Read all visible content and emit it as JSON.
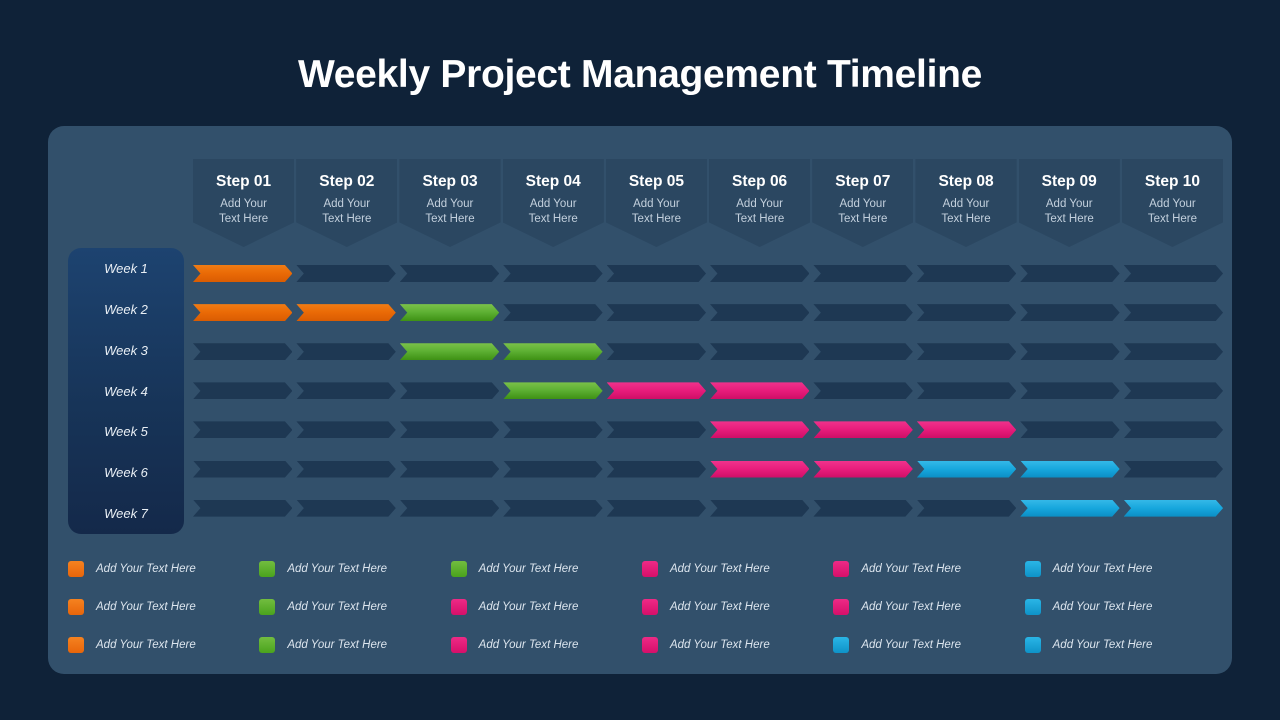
{
  "page": {
    "title": "Weekly Project Management Timeline",
    "background_color": "#0f2238",
    "panel_color": "#32506b"
  },
  "steps": [
    {
      "title": "Step 01",
      "subtitle": "Add Your\nText Here"
    },
    {
      "title": "Step 02",
      "subtitle": "Add Your\nText Here"
    },
    {
      "title": "Step 03",
      "subtitle": "Add Your\nText Here"
    },
    {
      "title": "Step 04",
      "subtitle": "Add Your\nText Here"
    },
    {
      "title": "Step 05",
      "subtitle": "Add Your\nText Here"
    },
    {
      "title": "Step 06",
      "subtitle": "Add Your\nText Here"
    },
    {
      "title": "Step 07",
      "subtitle": "Add Your\nText Here"
    },
    {
      "title": "Step 08",
      "subtitle": "Add Your\nText Here"
    },
    {
      "title": "Step 09",
      "subtitle": "Add Your\nText Here"
    },
    {
      "title": "Step 10",
      "subtitle": "Add Your\nText Here"
    }
  ],
  "weeks": [
    {
      "label": "Week 1"
    },
    {
      "label": "Week 2"
    },
    {
      "label": "Week 3"
    },
    {
      "label": "Week 4"
    },
    {
      "label": "Week 5"
    },
    {
      "label": "Week 6"
    },
    {
      "label": "Week 7"
    }
  ],
  "colors": {
    "orange": "#ea6a06",
    "green": "#5db033",
    "pink": "#e81d7c",
    "cyan": "#17a7dd",
    "empty": "#1e3853"
  },
  "chart_data": {
    "type": "gantt",
    "title": "Weekly Project Management Timeline",
    "xlabel": "",
    "ylabel": "",
    "categories": [
      "Step 01",
      "Step 02",
      "Step 03",
      "Step 04",
      "Step 05",
      "Step 06",
      "Step 07",
      "Step 08",
      "Step 09",
      "Step 10"
    ],
    "rows": [
      "Week 1",
      "Week 2",
      "Week 3",
      "Week 4",
      "Week 5",
      "Week 6",
      "Week 7"
    ],
    "cells": [
      [
        "orange",
        "empty",
        "empty",
        "empty",
        "empty",
        "empty",
        "empty",
        "empty",
        "empty",
        "empty"
      ],
      [
        "orange",
        "orange",
        "green",
        "empty",
        "empty",
        "empty",
        "empty",
        "empty",
        "empty",
        "empty"
      ],
      [
        "empty",
        "empty",
        "green",
        "green",
        "empty",
        "empty",
        "empty",
        "empty",
        "empty",
        "empty"
      ],
      [
        "empty",
        "empty",
        "empty",
        "green",
        "pink",
        "pink",
        "empty",
        "empty",
        "empty",
        "empty"
      ],
      [
        "empty",
        "empty",
        "empty",
        "empty",
        "empty",
        "pink",
        "pink",
        "pink",
        "empty",
        "empty"
      ],
      [
        "empty",
        "empty",
        "empty",
        "empty",
        "empty",
        "pink",
        "pink",
        "cyan",
        "cyan",
        "empty"
      ],
      [
        "empty",
        "empty",
        "empty",
        "empty",
        "empty",
        "empty",
        "empty",
        "empty",
        "cyan",
        "cyan"
      ]
    ],
    "legend": [
      {
        "color": "orange",
        "label": "Add Your Text Here"
      },
      {
        "color": "green",
        "label": "Add Your Text Here"
      },
      {
        "color": "green",
        "label": "Add Your Text Here"
      },
      {
        "color": "pink",
        "label": "Add Your Text Here"
      },
      {
        "color": "pink",
        "label": "Add Your Text Here"
      },
      {
        "color": "cyan",
        "label": "Add Your Text Here"
      },
      {
        "color": "orange",
        "label": "Add Your Text Here"
      },
      {
        "color": "green",
        "label": "Add Your Text Here"
      },
      {
        "color": "pink",
        "label": "Add Your Text Here"
      },
      {
        "color": "pink",
        "label": "Add Your Text Here"
      },
      {
        "color": "pink",
        "label": "Add Your Text Here"
      },
      {
        "color": "cyan",
        "label": "Add Your Text Here"
      },
      {
        "color": "orange",
        "label": "Add Your Text Here"
      },
      {
        "color": "green",
        "label": "Add Your Text Here"
      },
      {
        "color": "pink",
        "label": "Add Your Text Here"
      },
      {
        "color": "pink",
        "label": "Add Your Text Here"
      },
      {
        "color": "cyan",
        "label": "Add Your Text Here"
      },
      {
        "color": "cyan",
        "label": "Add Your Text Here"
      }
    ]
  }
}
